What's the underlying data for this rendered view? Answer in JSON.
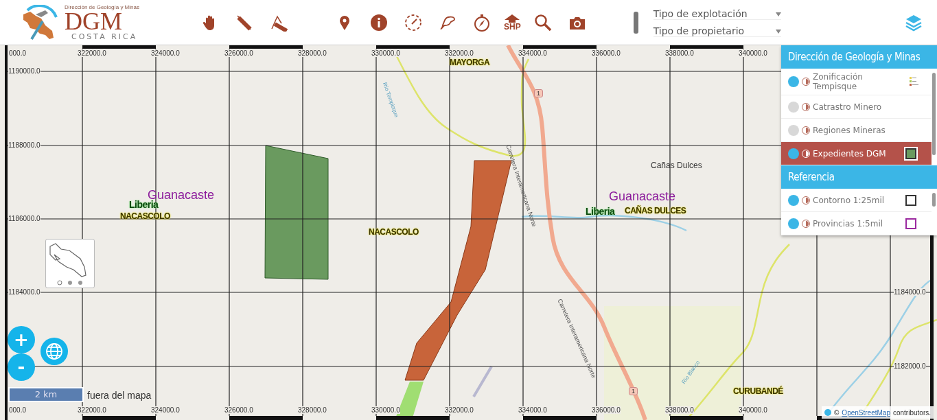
{
  "header": {
    "org_line": "Dirección de Geología y Minas",
    "acronym": "DGM",
    "country": "COSTA RICA"
  },
  "toolbar": {
    "export_label": "SHP"
  },
  "filters": [
    {
      "label": "Tipo de explotación"
    },
    {
      "label": "Tipo de propietario"
    }
  ],
  "map": {
    "top_ticks": [
      "000.0",
      "322000.0",
      "324000.0",
      "326000.0",
      "328000.0",
      "330000.0",
      "332000.0",
      "334000.0",
      "336000.0",
      "338000.0",
      "340000.0"
    ],
    "bottom_ticks": [
      "000.0",
      "322000.0",
      "324000.0",
      "326000.0",
      "328000.0",
      "330000.0",
      "332000.0",
      "334000.0",
      "336000.0",
      "338000.0",
      "340000.0"
    ],
    "left_ticks": [
      "1190000.0",
      "1188000.0",
      "1186000.0",
      "1184000.0"
    ],
    "right_ticks": [
      "1184000.0",
      "1182000.0"
    ],
    "places": [
      {
        "kind": "district",
        "text": "MAYORGA"
      },
      {
        "kind": "river",
        "text": "Río Tempisque"
      },
      {
        "kind": "shield",
        "text": "1"
      },
      {
        "kind": "road",
        "text": "Carretera Interamericana Norte"
      },
      {
        "kind": "town",
        "text": "Cañas Dulces"
      },
      {
        "kind": "province",
        "text": "Guanacaste"
      },
      {
        "kind": "province",
        "text": "Guanacaste"
      },
      {
        "kind": "canton",
        "text": "Liberia"
      },
      {
        "kind": "canton",
        "text": "Liberia"
      },
      {
        "kind": "district",
        "text": "CAÑAS DULCES"
      },
      {
        "kind": "district",
        "text": "NACASCOLO"
      },
      {
        "kind": "district",
        "text": "NACASCOLO"
      },
      {
        "kind": "road",
        "text": "Carretera Interamericana Norte"
      },
      {
        "kind": "river",
        "text": "Río Blanco"
      },
      {
        "kind": "shield",
        "text": "1"
      },
      {
        "kind": "district",
        "text": "CURUBANDÉ"
      }
    ],
    "zoom_in": "+",
    "zoom_out": "-",
    "scale": "2 km",
    "out_of_map": "fuera del mapa",
    "attribution": {
      "prefix": "©",
      "link": "OpenStreetMap",
      "suffix": "contributors."
    }
  },
  "layers": [
    {
      "title": "Dirección de Geología y Minas",
      "items": [
        {
          "name": "Zonificación Tempisque",
          "on": true,
          "selected": false,
          "kind": "image"
        },
        {
          "name": "Catrastro Minero",
          "on": false,
          "selected": false,
          "kind": "plain"
        },
        {
          "name": "Regiones Mineras",
          "on": false,
          "selected": false,
          "kind": "plain"
        },
        {
          "name": "Expedientes DGM",
          "on": true,
          "selected": true,
          "kind": "swatch",
          "color": "#6a9a5f"
        }
      ]
    },
    {
      "title": "Referencia",
      "items": [
        {
          "name": "Contorno 1:25mil",
          "on": true,
          "selected": false,
          "kind": "outline",
          "color": "#333333"
        },
        {
          "name": "Provincias 1:5mil",
          "on": true,
          "selected": false,
          "kind": "outline",
          "color": "#9b2aa0"
        }
      ]
    }
  ]
}
